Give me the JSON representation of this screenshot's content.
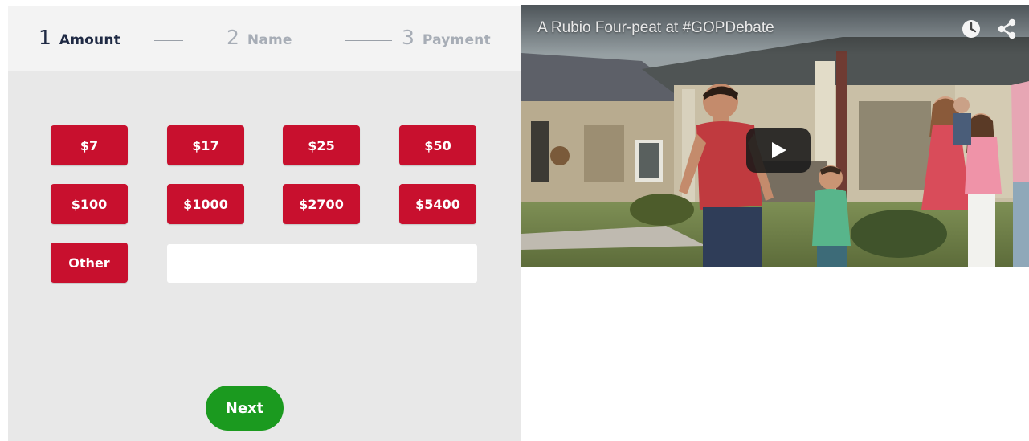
{
  "stepper": {
    "steps": [
      {
        "number": "1",
        "label": "Amount",
        "state": "active"
      },
      {
        "number": "2",
        "label": "Name",
        "state": "inactive"
      },
      {
        "number": "3",
        "label": "Payment",
        "state": "inactive"
      }
    ]
  },
  "amounts": {
    "options": [
      "$7",
      "$17",
      "$25",
      "$50",
      "$100",
      "$1000",
      "$2700",
      "$5400"
    ],
    "other_label": "Other",
    "other_value": ""
  },
  "actions": {
    "next_label": "Next"
  },
  "video": {
    "title": "A Rubio Four-peat at #GOPDebate",
    "icons": [
      "clock-icon",
      "share-icon",
      "play-icon"
    ]
  },
  "colors": {
    "amount_button": "#c8102e",
    "next_button": "#1b9a1f",
    "panel_background": "#e8e8e8",
    "stepper_background": "#f3f3f3",
    "active_step": "#1f2a44",
    "inactive_step": "#a7adb6"
  }
}
